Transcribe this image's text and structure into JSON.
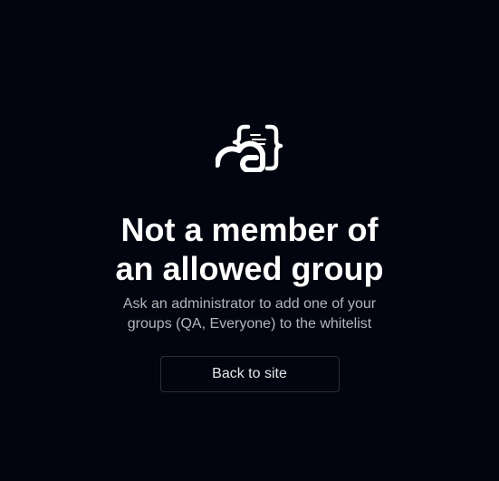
{
  "logo": {
    "icon": "cloud-code-logo-icon",
    "color": "#ffffff"
  },
  "error": {
    "title_line1": "Not a member of",
    "title_line2": "an allowed group",
    "message": "Ask an administrator to add one of your groups (QA, Everyone) to the whitelist"
  },
  "actions": {
    "back_label": "Back to site"
  },
  "colors": {
    "background": "#02040f",
    "text": "#ffffff",
    "muted_text": "#b3b5bd",
    "button_border": "#2b2e38"
  }
}
